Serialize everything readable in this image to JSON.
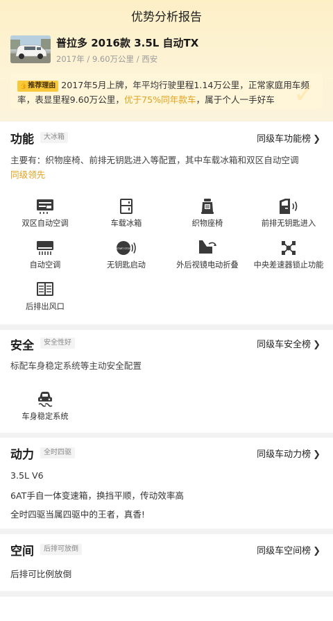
{
  "page": {
    "title": "优势分析报告"
  },
  "car": {
    "name": "普拉多 2016款 3.5L 自动TX",
    "meta": "2017年 / 9.60万公里 / 西安"
  },
  "reason": {
    "tag": "推荐理由",
    "text_before": "2017年5月上牌，年平均行驶里程1.14万公里，正常家庭用车频率，表显里程9.60万公里，",
    "highlight": "优于75%同年款车",
    "text_after": "，属于个人一手好车"
  },
  "function": {
    "title": "功能",
    "badge": "大冰箱",
    "link": "同级车功能榜",
    "desc": "主要有：织物座椅、前排无钥匙进入等配置，其中车载冰箱和双区自动空调",
    "lead": "同级领先",
    "features": [
      {
        "icon": "dual-zone-ac-icon",
        "label": "双区自动空调"
      },
      {
        "icon": "car-fridge-icon",
        "label": "车载冰箱"
      },
      {
        "icon": "fabric-seat-icon",
        "label": "织物座椅"
      },
      {
        "icon": "keyless-entry-icon",
        "label": "前排无钥匙进入"
      },
      {
        "icon": "auto-ac-icon",
        "label": "自动空调"
      },
      {
        "icon": "keyless-start-icon",
        "label": "无钥匙启动"
      },
      {
        "icon": "power-fold-mirror-icon",
        "label": "外后视镜电动折叠"
      },
      {
        "icon": "center-diff-lock-icon",
        "label": "中央差速器锁止功能"
      },
      {
        "icon": "rear-vent-icon",
        "label": "后排出风口"
      }
    ],
    "keyless_start_text": "START STOP"
  },
  "safety": {
    "title": "安全",
    "badge": "安全性好",
    "link": "同级车安全榜",
    "desc": "标配车身稳定系统等主动安全配置",
    "features": [
      {
        "icon": "esp-icon",
        "label": "车身稳定系统"
      }
    ]
  },
  "power": {
    "title": "动力",
    "badge": "全时四驱",
    "link": "同级车动力榜",
    "lines": [
      "3.5L V6",
      "6AT手自一体变速箱，换挡平顺，传动效率高",
      "全时四驱当属四驱中的王者，真香!"
    ]
  },
  "space": {
    "title": "空间",
    "badge": "后排可放倒",
    "link": "同级车空间榜",
    "desc": "后排可比例放倒"
  },
  "colors": {
    "accent": "#e0a21e",
    "tag_bg": "#f9c93c",
    "header_bg": "#fdf0c7",
    "reason_bg": "#fff6da"
  }
}
